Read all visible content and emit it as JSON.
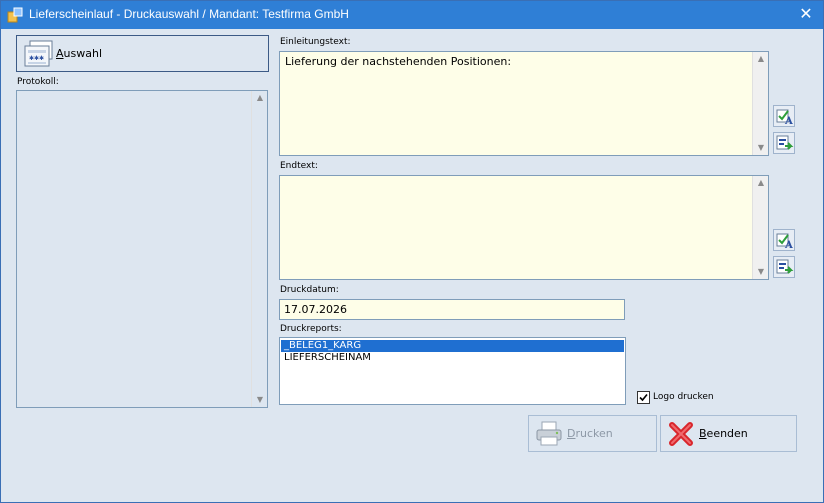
{
  "window": {
    "title": "Lieferscheinlauf - Druckauswahl / Mandant: Testfirma GmbH",
    "close_glyph": "✕"
  },
  "left": {
    "auswahl_first": "A",
    "auswahl_rest": "uswahl",
    "protokoll_label": "Protokoll:"
  },
  "einleitung": {
    "label": "Einleitungstext:",
    "text": "Lieferung der nachstehenden Positionen:"
  },
  "endtext": {
    "label": "Endtext:",
    "text": ""
  },
  "druckdatum": {
    "label": "Druckdatum:",
    "value": "17.07.2026"
  },
  "druckreports": {
    "label": "Druckreports:",
    "items": [
      "_BELEG1_KARG",
      "LIEFERSCHEINAM"
    ],
    "selected_index": 0
  },
  "logo": {
    "label": "Logo drucken",
    "checked": true
  },
  "buttons": {
    "drucken_first": "D",
    "drucken_rest": "rucken",
    "beenden_first": "B",
    "beenden_rest": "eenden"
  },
  "icons": {
    "app": "app-icon",
    "auswahl": "selection-form-icon",
    "edit_text": "edit-text-icon",
    "import_text": "import-text-icon",
    "printer": "printer-icon",
    "cancel": "red-x-icon"
  },
  "colors": {
    "titlebar": "#2f7fd6",
    "window_bg": "#dde6f0",
    "textarea_bg": "#fefee8",
    "selection": "#1f6fd1",
    "cancel_red": "#d9262c"
  }
}
